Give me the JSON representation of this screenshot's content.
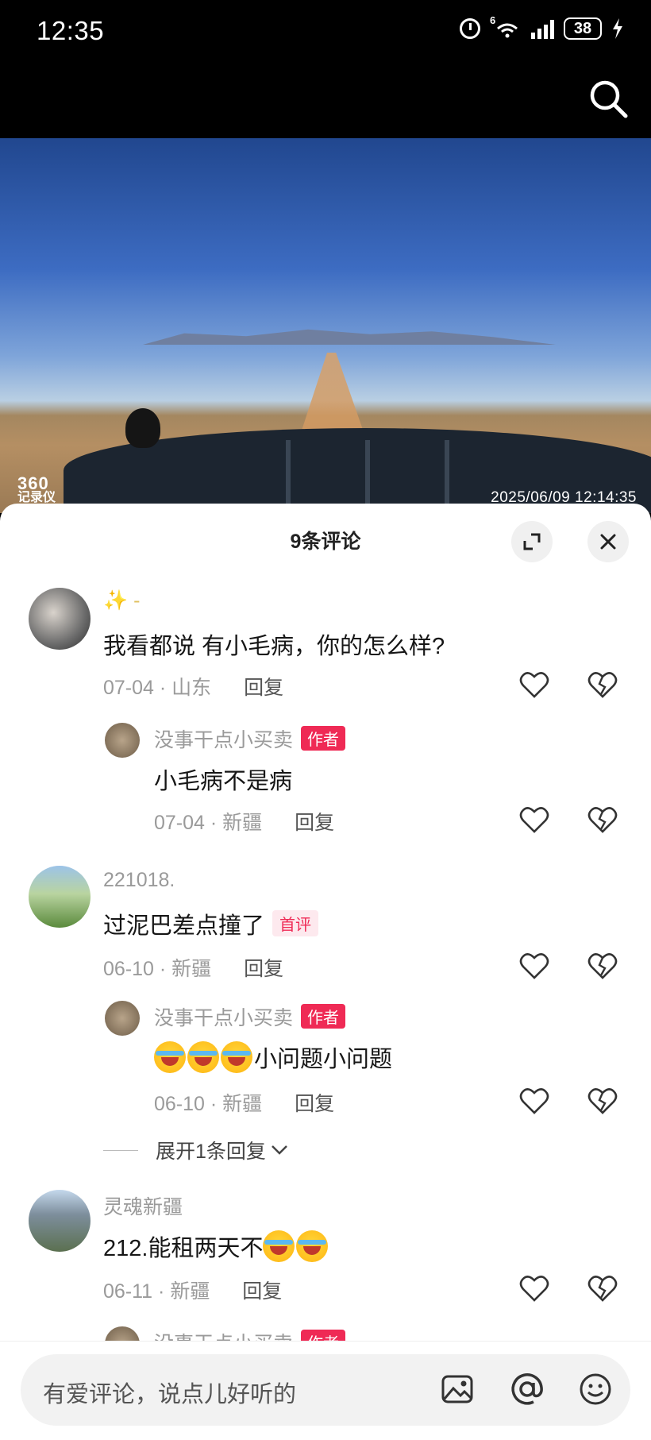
{
  "status_bar": {
    "time": "12:35",
    "battery": "38",
    "network_label": "6"
  },
  "video": {
    "watermark_line1": "360",
    "watermark_line2": "记录仪",
    "timestamp": "2025/06/09  12:14:35"
  },
  "comments_panel": {
    "title": "9条评论",
    "comments": [
      {
        "user": "✨ -",
        "text": "我看都说 有小毛病，你的怎么样?",
        "date": "07-04",
        "location": "山东",
        "reply_label": "回复"
      },
      {
        "user": "没事干点小买卖",
        "badge": "作者",
        "text": "小毛病不是病",
        "date": "07-04",
        "location": "新疆",
        "reply_label": "回复"
      },
      {
        "user": "221018.",
        "text": "过泥巴差点撞了",
        "badge": "首评",
        "date": "06-10",
        "location": "新疆",
        "reply_label": "回复"
      },
      {
        "user": "没事干点小买卖",
        "badge": "作者",
        "text": "小问题小问题",
        "date": "06-10",
        "location": "新疆",
        "reply_label": "回复"
      },
      {
        "user": "灵魂新疆",
        "text": "212.能租两天不",
        "date": "06-11",
        "location": "新疆",
        "reply_label": "回复"
      },
      {
        "user": "没事干点小买卖",
        "badge": "作者"
      }
    ],
    "expand_replies": "展开1条回复"
  },
  "input": {
    "placeholder": "有爱评论，说点儿好听的"
  },
  "icons": [
    "search-icon",
    "expand-icon",
    "close-icon",
    "heart-icon",
    "broken-heart-icon",
    "image-icon",
    "at-icon",
    "emoji-icon",
    "chevron-down-icon"
  ],
  "colors": {
    "author_badge": "#ef2a55",
    "first_badge_bg": "#fde9ee"
  }
}
